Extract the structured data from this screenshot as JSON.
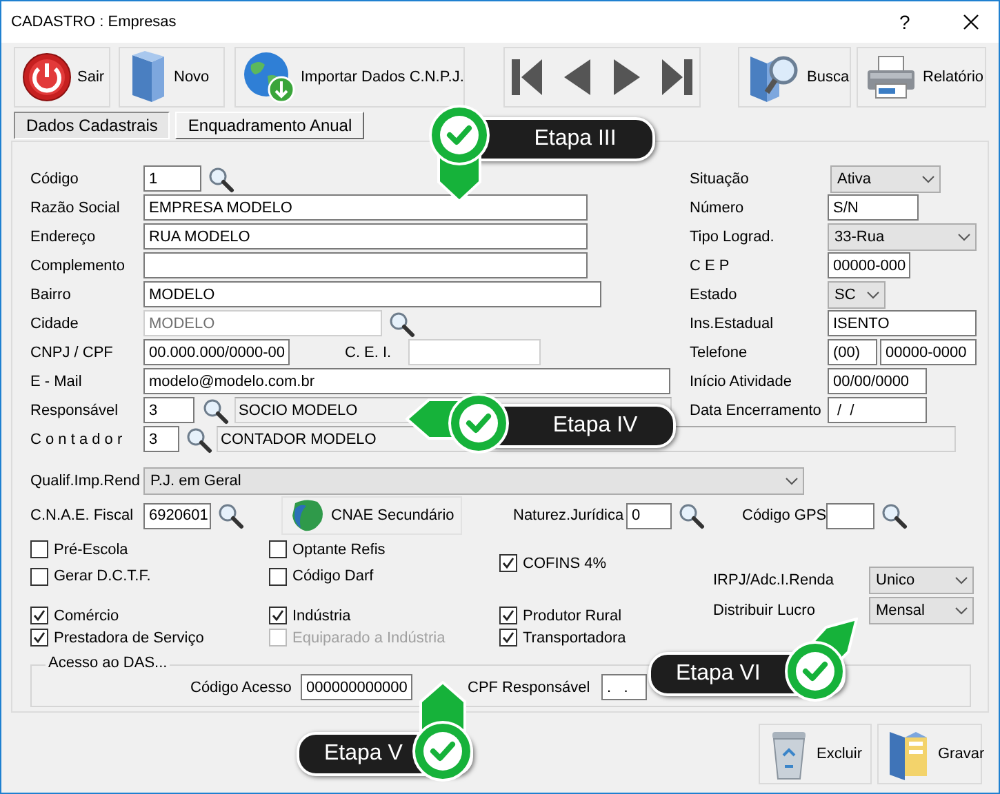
{
  "window": {
    "title": "CADASTRO : Empresas",
    "help_button": "?"
  },
  "toolbar": [
    {
      "label": "Sair"
    },
    {
      "label": "Novo"
    },
    {
      "label": "Importar Dados C.N.P.J."
    },
    {
      "label": "Busca"
    },
    {
      "label": "Relatório"
    }
  ],
  "tabs": [
    {
      "label": "Dados Cadastrais",
      "selected": true
    },
    {
      "label": "Enquadramento Anual",
      "selected": false
    }
  ],
  "left_fields": [
    {
      "controls": [
        {
          "kind": "label",
          "text": "Código"
        },
        {
          "kind": "text",
          "value": "1"
        },
        {
          "kind": "lookup"
        }
      ]
    },
    {
      "controls": [
        {
          "kind": "label",
          "text": "Razão Social"
        },
        {
          "kind": "text",
          "value": "EMPRESA MODELO"
        }
      ]
    },
    {
      "controls": [
        {
          "kind": "label",
          "text": "Endereço"
        },
        {
          "kind": "text",
          "value": "RUA MODELO"
        }
      ]
    },
    {
      "controls": [
        {
          "kind": "label",
          "text": "Complemento"
        },
        {
          "kind": "text"
        }
      ]
    },
    {
      "controls": [
        {
          "kind": "label",
          "text": "Bairro"
        },
        {
          "kind": "text",
          "value": "MODELO"
        }
      ]
    },
    {
      "controls": [
        {
          "kind": "label",
          "text": "Cidade"
        },
        {
          "kind": "text",
          "value": "MODELO",
          "disabled": true
        },
        {
          "kind": "lookup"
        }
      ]
    },
    {
      "controls": [
        {
          "kind": "label",
          "text": "CNPJ / CPF"
        },
        {
          "kind": "text",
          "value": "00.000.000/0000-00"
        },
        {
          "kind": "label",
          "text": "C. E. I."
        },
        {
          "kind": "text",
          "disabled": true
        }
      ]
    },
    {
      "controls": [
        {
          "kind": "label",
          "text": "E - Mail"
        },
        {
          "kind": "text",
          "value": "modelo@modelo.com.br"
        }
      ]
    },
    {
      "controls": [
        {
          "kind": "label",
          "text": "Responsável"
        },
        {
          "kind": "text",
          "value": "3"
        },
        {
          "kind": "lookup"
        },
        {
          "kind": "display",
          "value": "SOCIO MODELO"
        }
      ]
    }
  ],
  "right_fields": [
    {
      "controls": [
        {
          "kind": "label",
          "text": "Situação"
        },
        {
          "kind": "select",
          "value": "Ativa"
        }
      ]
    },
    {
      "controls": [
        {
          "kind": "label",
          "text": "Número"
        },
        {
          "kind": "text",
          "value": "S/N"
        }
      ]
    },
    {
      "controls": [
        {
          "kind": "label",
          "text": "Tipo Lograd."
        },
        {
          "kind": "select",
          "value": "33-Rua"
        }
      ]
    },
    {
      "controls": [
        {
          "kind": "label",
          "text": "C E P"
        },
        {
          "kind": "text",
          "value": "00000-000"
        }
      ]
    },
    {
      "controls": [
        {
          "kind": "label",
          "text": "Estado"
        },
        {
          "kind": "select",
          "value": "SC"
        }
      ]
    },
    {
      "controls": [
        {
          "kind": "label",
          "text": "Ins.Estadual"
        },
        {
          "kind": "text",
          "value": "ISENTO"
        }
      ]
    },
    {
      "controls": [
        {
          "kind": "label",
          "text": "Telefone"
        },
        {
          "kind": "text",
          "value": "(00)"
        },
        {
          "kind": "text",
          "value": "00000-0000"
        }
      ]
    },
    {
      "controls": [
        {
          "kind": "label",
          "text": "Início Atividade"
        },
        {
          "kind": "text",
          "value": "00/00/0000"
        }
      ]
    },
    {
      "controls": [
        {
          "kind": "label",
          "text": "Data Encerramento"
        },
        {
          "kind": "text",
          "value": " /  /"
        }
      ]
    }
  ],
  "contador_row": {
    "controls": [
      {
        "kind": "label",
        "text": "C o n t a d o r"
      },
      {
        "kind": "text",
        "value": "3"
      },
      {
        "kind": "lookup"
      },
      {
        "kind": "display",
        "value": "CONTADOR MODELO"
      }
    ]
  },
  "qualif_row": {
    "controls": [
      {
        "kind": "label",
        "text": "Qualif.Imp.Rend"
      },
      {
        "kind": "select",
        "value": "P.J. em Geral"
      }
    ]
  },
  "cnae_row": {
    "controls": [
      {
        "kind": "label",
        "text": "C.N.A.E. Fiscal"
      },
      {
        "kind": "text",
        "value": "6920601"
      },
      {
        "kind": "lookup"
      },
      {
        "kind": "button",
        "text": "CNAE Secundário"
      },
      {
        "kind": "label",
        "text": "Naturez.Jurídica"
      },
      {
        "kind": "text",
        "value": "0"
      },
      {
        "kind": "lookup"
      },
      {
        "kind": "label",
        "text": "Código GPS"
      },
      {
        "kind": "text"
      },
      {
        "kind": "lookup"
      }
    ]
  },
  "checkboxes": [
    {
      "label": "Pré-Escola",
      "checked": false,
      "disabled": false
    },
    {
      "label": "Optante Refis",
      "checked": false,
      "disabled": false
    },
    {
      "label": "COFINS 4%",
      "checked": true,
      "disabled": false
    },
    {
      "label": "Gerar D.C.T.F.",
      "checked": false,
      "disabled": false
    },
    {
      "label": "Código Darf",
      "checked": false,
      "disabled": false
    },
    {
      "label": "Comércio",
      "checked": true,
      "disabled": false
    },
    {
      "label": "Indústria",
      "checked": true,
      "disabled": false
    },
    {
      "label": "Produtor Rural",
      "checked": true,
      "disabled": false
    },
    {
      "label": "Prestadora de Serviço",
      "checked": true,
      "disabled": false
    },
    {
      "label": "Equiparado a Indústria",
      "checked": false,
      "disabled": true
    },
    {
      "label": "Transportadora",
      "checked": true,
      "disabled": false
    }
  ],
  "tax_options": [
    {
      "label": "IRPJ/Adc.I.Renda",
      "value": "Unico"
    },
    {
      "label": "Distribuir Lucro",
      "value": "Mensal"
    }
  ],
  "das": {
    "legend": "Acesso ao DAS...",
    "controls": [
      {
        "kind": "label",
        "text": "Código Acesso"
      },
      {
        "kind": "text",
        "value": "000000000000"
      },
      {
        "kind": "label",
        "text": "CPF Responsável"
      },
      {
        "kind": "text",
        "value": ".   ."
      }
    ]
  },
  "actions": [
    {
      "label": "Excluir"
    },
    {
      "label": "Gravar"
    }
  ],
  "callouts": [
    {
      "label": "Etapa III"
    },
    {
      "label": "Etapa IV"
    },
    {
      "label": "Etapa VI"
    },
    {
      "label": "Etapa V"
    }
  ]
}
